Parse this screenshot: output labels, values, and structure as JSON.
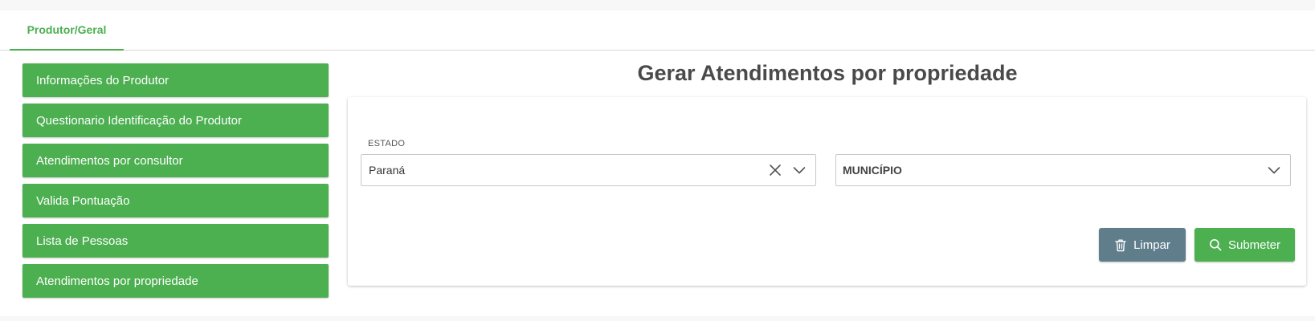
{
  "tabs": [
    {
      "label": "Produtor/Geral",
      "active": true
    }
  ],
  "sidebar": {
    "items": [
      {
        "label": "Informações do Produtor"
      },
      {
        "label": "Questionario Identificação do Produtor"
      },
      {
        "label": "Atendimentos por consultor"
      },
      {
        "label": "Valida Pontuação"
      },
      {
        "label": "Lista de Pessoas"
      },
      {
        "label": "Atendimentos por propriedade"
      }
    ]
  },
  "main": {
    "title": "Gerar Atendimentos por propriedade",
    "form": {
      "estado": {
        "label": "ESTADO",
        "value": "Paraná",
        "clear_icon": "close-icon",
        "dropdown_icon": "chevron-down-icon"
      },
      "municipio": {
        "placeholder": "MUNICÍPIO",
        "dropdown_icon": "chevron-down-icon"
      }
    },
    "buttons": {
      "limpar": {
        "label": "Limpar",
        "icon": "trash-icon"
      },
      "submeter": {
        "label": "Submeter",
        "icon": "search-icon"
      }
    }
  },
  "colors": {
    "primary_green": "#4caf50",
    "secondary_slate": "#607d8b",
    "title_text": "#4a4a4a"
  }
}
